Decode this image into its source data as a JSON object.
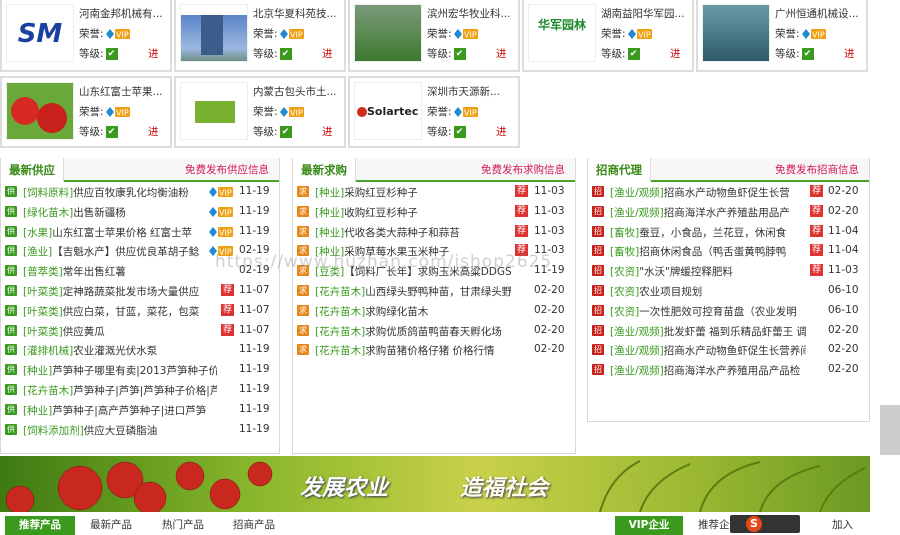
{
  "cards": [
    {
      "title": "河南金邦机械有...",
      "rep_label": "荣誉:",
      "lvl_label": "等级:",
      "go": "进",
      "logo": "sm-logo"
    },
    {
      "title": "北京华夏科苑技...",
      "rep_label": "荣誉:",
      "lvl_label": "等级:",
      "go": "进",
      "logo": "building-photo"
    },
    {
      "title": "滨州宏华牧业科...",
      "rep_label": "荣誉:",
      "lvl_label": "等级:",
      "go": "进",
      "logo": "farm-photo"
    },
    {
      "title": "湖南益阳华军园...",
      "rep_label": "荣誉:",
      "lvl_label": "等级:",
      "go": "进",
      "logo": "huajun-logo"
    },
    {
      "title": "广州恒通机械设...",
      "rep_label": "荣誉:",
      "lvl_label": "等级:",
      "go": "进",
      "logo": "machine-photo"
    },
    {
      "title": "山东红富士苹果...",
      "rep_label": "荣誉:",
      "lvl_label": "等级:",
      "go": "进",
      "logo": "apple-photo"
    },
    {
      "title": "内蒙古包头市土...",
      "rep_label": "荣誉:",
      "lvl_label": "等级:",
      "go": "进",
      "logo": "tree-photo"
    },
    {
      "title": "深圳市天源新...",
      "rep_label": "荣誉:",
      "lvl_label": "等级:",
      "go": "进",
      "logo": "solartec-logo",
      "logo_text": "Solartec"
    }
  ],
  "logo_sm": "SM",
  "logo_huajun": "华军园林",
  "supply": {
    "title": "最新供应",
    "more": "免费发布供应信息",
    "items": [
      {
        "cat": "[饲料原料]",
        "text": "供应百牧康乳化均衡油粉",
        "vip": true,
        "date": "11-19"
      },
      {
        "cat": "[绿化苗木]",
        "text": "出售新疆杨",
        "vip": true,
        "date": "11-19"
      },
      {
        "cat": "[水果]",
        "text": "山东红富士苹果价格 红富士苹",
        "vip": true,
        "date": "11-19"
      },
      {
        "cat": "[渔业]",
        "text": "【吉魁水产】供应优良革胡子鲶",
        "vip": true,
        "date": "02-19"
      },
      {
        "cat": "[普萃类]",
        "text": "常年出售红薯",
        "vip": false,
        "date": "02-19"
      },
      {
        "cat": "[叶菜类]",
        "text": "定神路蔬菜批发市场大量供应",
        "tj": true,
        "date": "11-07"
      },
      {
        "cat": "[叶菜类]",
        "text": "供应白菜，甘蓝，菜花，包菜",
        "tj": true,
        "date": "11-07"
      },
      {
        "cat": "[叶菜类]",
        "text": "供应黄瓜",
        "tj": true,
        "date": "11-07"
      },
      {
        "cat": "[灌排机械]",
        "text": "农业灌溉光伏水泵",
        "tj": false,
        "date": "11-19"
      },
      {
        "cat": "[种业]",
        "text": "芦笋种子哪里有卖|2013芦笋种子价",
        "tj": false,
        "date": "11-19"
      },
      {
        "cat": "[花卉苗木]",
        "text": "芦笋种子|芦笋|芦笋种子价格|芦",
        "tj": false,
        "date": "11-19"
      },
      {
        "cat": "[种业]",
        "text": "芦笋种子|高产芦笋种子|进口芦笋",
        "tj": false,
        "date": "11-19"
      },
      {
        "cat": "[饲料添加剂]",
        "text": "供应大豆磷脂油",
        "tj": false,
        "date": "11-19"
      }
    ]
  },
  "demand": {
    "title": "最新求购",
    "more": "免费发布求购信息",
    "items": [
      {
        "cat": "[种业]",
        "text": "采购红豆杉种子",
        "tj": true,
        "date": "11-03"
      },
      {
        "cat": "[种业]",
        "text": "收购红豆杉种子",
        "tj": true,
        "date": "11-03"
      },
      {
        "cat": "[种业]",
        "text": "代收各类大蒜种子和蒜苔",
        "tj": true,
        "date": "11-03"
      },
      {
        "cat": "[种业]",
        "text": "采购草莓水果玉米种子",
        "tj": true,
        "date": "11-03"
      },
      {
        "cat": "[豆类]",
        "text": "【饲料厂长年】求购玉米高粱DDGS",
        "tj": false,
        "date": "11-19"
      },
      {
        "cat": "[花卉苗木]",
        "text": "山西绿头野鸭种苗，甘肃绿头野",
        "tj": false,
        "date": "02-20"
      },
      {
        "cat": "[花卉苗木]",
        "text": "求购绿化苗木",
        "tj": false,
        "date": "02-20"
      },
      {
        "cat": "[花卉苗木]",
        "text": "求购优质鸽苗鸭苗春天孵化场",
        "tj": false,
        "date": "02-20"
      },
      {
        "cat": "[花卉苗木]",
        "text": "求购苗猪价格仔猪 价格行情",
        "tj": false,
        "date": "02-20"
      }
    ]
  },
  "agency": {
    "title": "招商代理",
    "more": "免费发布招商信息",
    "items": [
      {
        "cat": "[渔业/观频]",
        "text": "招商水产动物鱼虾促生长营",
        "tj": true,
        "date": "02-20"
      },
      {
        "cat": "[渔业/观频]",
        "text": "招商海洋水产养殖盐用品产",
        "tj": true,
        "date": "02-20"
      },
      {
        "cat": "[畜牧]",
        "text": "蚕豆，小食品，兰花豆，休闲食",
        "tj": true,
        "date": "11-04"
      },
      {
        "cat": "[畜牧]",
        "text": "招商休闲食品（鸭舌蛋黄鸭脖鸭",
        "tj": true,
        "date": "11-04"
      },
      {
        "cat": "[农资]",
        "text": "\"水沃\"牌缓控释肥料",
        "tj": true,
        "date": "11-03"
      },
      {
        "cat": "[农资]",
        "text": "农业项目规划",
        "tj": false,
        "date": "06-10"
      },
      {
        "cat": "[农资]",
        "text": "一次性肥效可控育苗盘（农业发明",
        "tj": false,
        "date": "06-10"
      },
      {
        "cat": "[渔业/观频]",
        "text": "批发虾蕾 福到乐精品虾蕾王 调",
        "tj": false,
        "date": "02-20"
      },
      {
        "cat": "[渔业/观频]",
        "text": "招商水产动物鱼虾促生长营养间",
        "tj": false,
        "date": "02-20"
      },
      {
        "cat": "[渔业/观频]",
        "text": "招商海洋水产养殖用品产品检",
        "tj": false,
        "date": "02-20"
      }
    ]
  },
  "banner": {
    "slogan1": "发展农业",
    "slogan2": "造福社会"
  },
  "watermark": "https://www.huzhan.com/ishop2625",
  "bottom_tabs": {
    "recommend": "推荐产品",
    "latest": "最新产品",
    "hot": "热门产品",
    "invest": "招商产品",
    "vip": "VIP企业",
    "recommend2": "推荐企",
    "join": "加入"
  },
  "colors": {
    "green": "#3a9a1e",
    "red": "#d4145a",
    "tab_green": "#4aa32a"
  },
  "icons": {
    "supply": "供",
    "demand": "求",
    "agency": "招",
    "recommend": "荐"
  }
}
